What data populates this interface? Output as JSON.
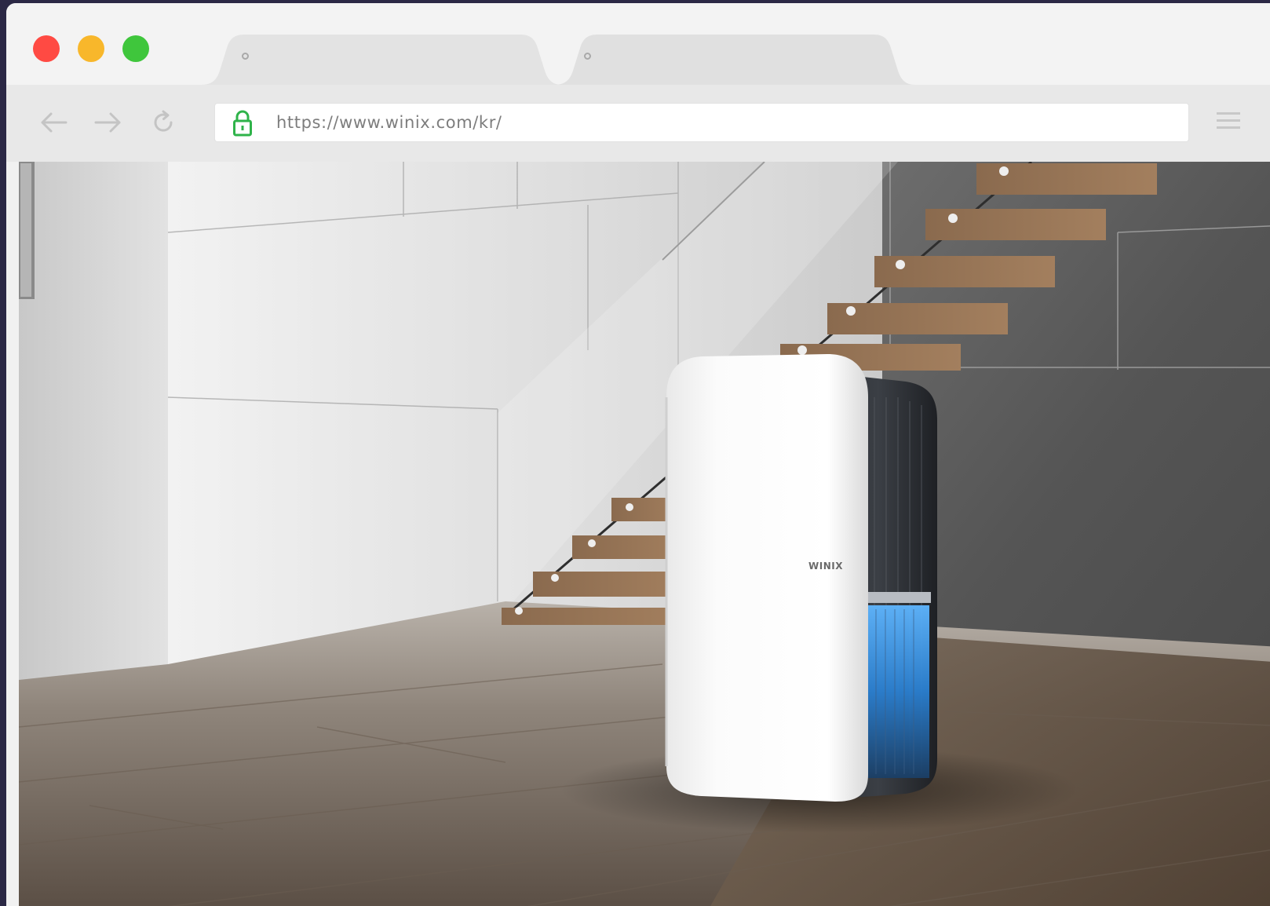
{
  "browser": {
    "url": "https://www.winix.com/kr/",
    "window_controls": [
      {
        "name": "close",
        "color": "#ff4a43"
      },
      {
        "name": "minimize",
        "color": "#f8b72b"
      },
      {
        "name": "maximize",
        "color": "#3fc63c"
      }
    ],
    "tabs": [
      {
        "label": "",
        "active": false
      },
      {
        "label": "",
        "active": false
      }
    ],
    "icons": {
      "back": "arrow-left-icon",
      "forward": "arrow-right-icon",
      "reload": "reload-icon",
      "secure": "lock-icon",
      "menu": "hamburger-menu-icon"
    },
    "lock_color": "#2fb34a"
  },
  "page": {
    "hero_image": "dehumidifier-in-modern-interior",
    "product_brand": "WINIX"
  }
}
